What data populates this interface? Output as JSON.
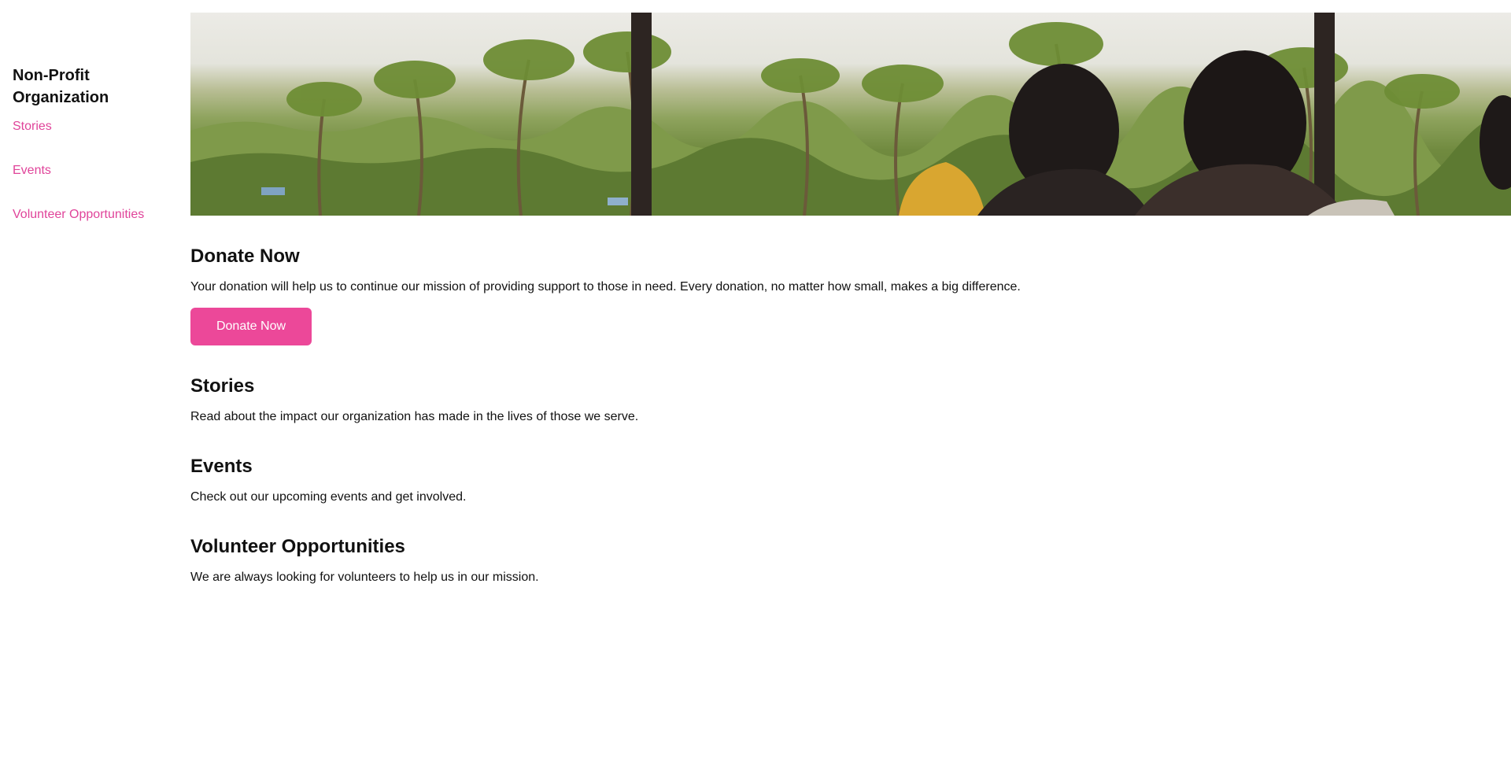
{
  "sidebar": {
    "org_title": "Non-Profit Organization",
    "nav": [
      {
        "label": "Stories"
      },
      {
        "label": "Events"
      },
      {
        "label": "Volunteer Opportunities"
      }
    ]
  },
  "hero": {
    "alt": "Palm trees and people overlooking a tropical landscape"
  },
  "donate": {
    "heading": "Donate Now",
    "text": "Your donation will help us to continue our mission of providing support to those in need. Every donation, no matter how small, makes a big difference.",
    "button_label": "Donate Now"
  },
  "stories": {
    "heading": "Stories",
    "text": "Read about the impact our organization has made in the lives of those we serve."
  },
  "events": {
    "heading": "Events",
    "text": "Check out our upcoming events and get involved."
  },
  "volunteer": {
    "heading": "Volunteer Opportunities",
    "text": "We are always looking for volunteers to help us in our mission."
  },
  "colors": {
    "accent": "#ec4899",
    "link": "#e0449a",
    "text": "#111111"
  }
}
